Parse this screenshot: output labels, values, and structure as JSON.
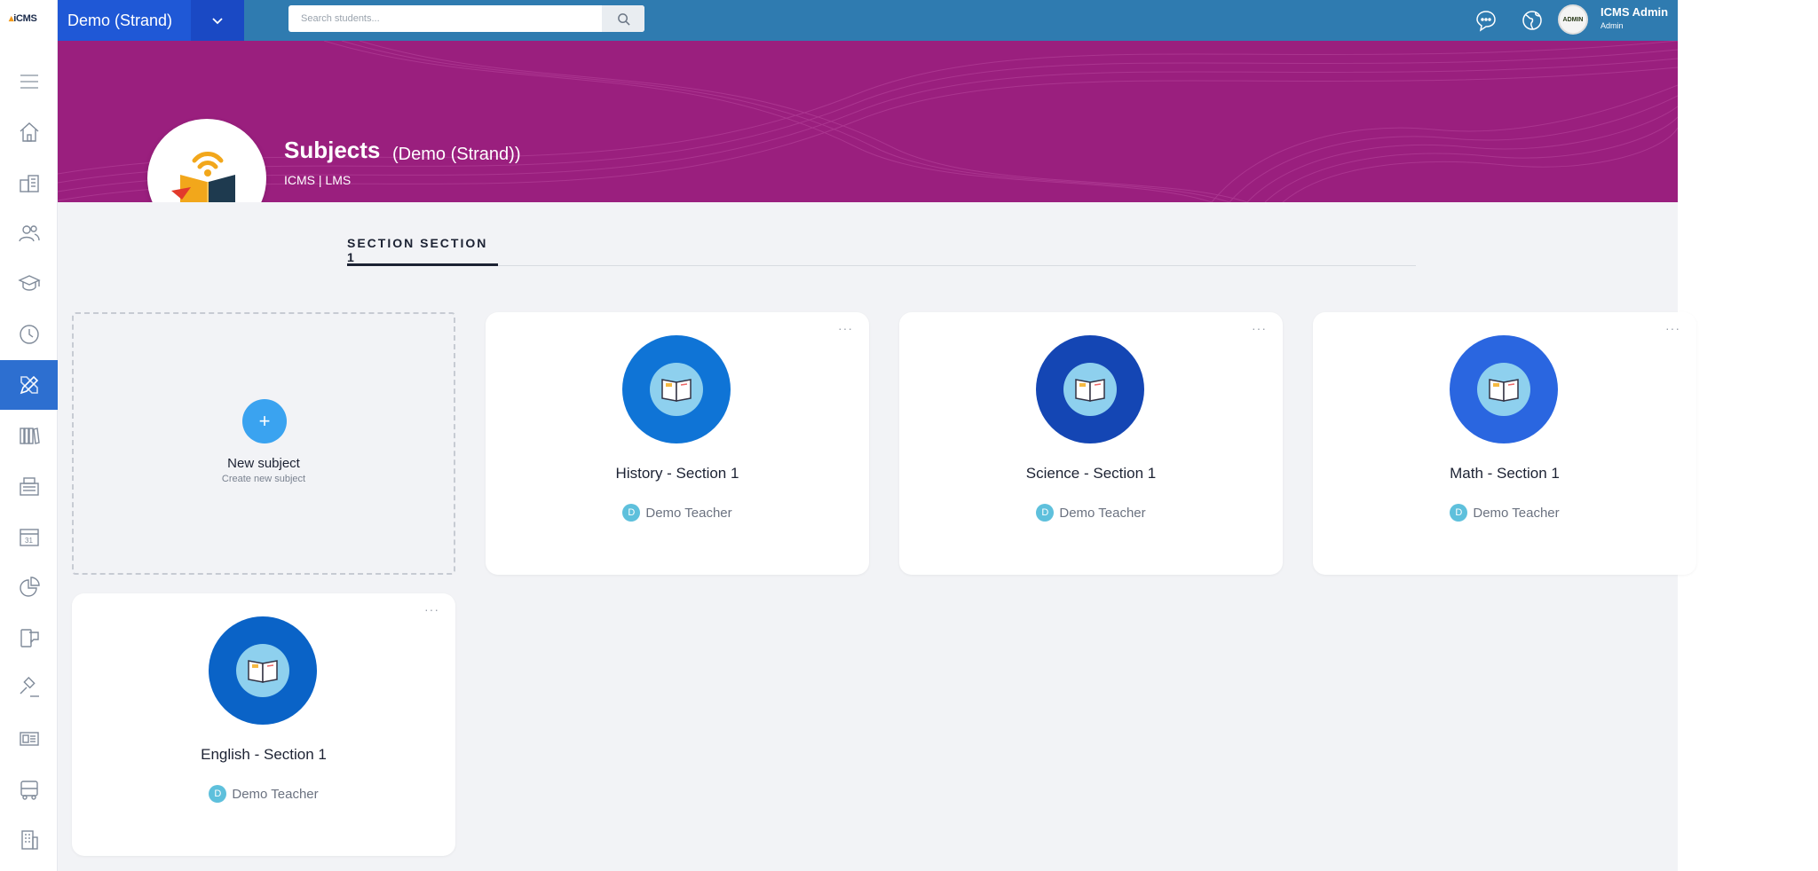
{
  "app": {
    "logo_text": "iCMS",
    "school_name": "Demo (Strand)"
  },
  "search": {
    "placeholder": "Search students..."
  },
  "user": {
    "name": "ICMS Admin",
    "role": "Admin",
    "avatar_text": "ADMIN"
  },
  "page": {
    "title": "Subjects",
    "subtitle": "(Demo (Strand))",
    "crumb": "ICMS | LMS"
  },
  "tabs": [
    {
      "label": "SECTION SECTION 1"
    }
  ],
  "new_subject": {
    "plus": "+",
    "title": "New subject",
    "subtitle": "Create new subject"
  },
  "subjects": [
    {
      "title": "History - Section 1",
      "teacher": "Demo Teacher",
      "initial": "D",
      "color": "#0f74d6"
    },
    {
      "title": "Science - Section 1",
      "teacher": "Demo Teacher",
      "initial": "D",
      "color": "#1446b4"
    },
    {
      "title": "Math - Section 1",
      "teacher": "Demo Teacher",
      "initial": "D",
      "color": "#2a66e0"
    },
    {
      "title": "English - Section 1",
      "teacher": "Demo Teacher",
      "initial": "D",
      "color": "#0a63c7"
    }
  ],
  "card_menu_glyph": "···",
  "colors": {
    "topbar": "#2f7bb0",
    "school_select": "#1f58d6",
    "banner": "#9a1f7e",
    "active_nav": "#2d6fd0",
    "content_bg": "#f2f3f6",
    "new_button": "#3aa3f0"
  },
  "sidebar_icons": [
    "menu-icon",
    "home-icon",
    "school-icon",
    "users-icon",
    "graduation-cap-icon",
    "clock-icon",
    "pencil-ruler-icon",
    "library-icon",
    "cashier-icon",
    "calendar-icon",
    "pie-chart-icon",
    "mobile-chat-icon",
    "gavel-icon",
    "id-card-icon",
    "bus-icon",
    "building-icon"
  ]
}
